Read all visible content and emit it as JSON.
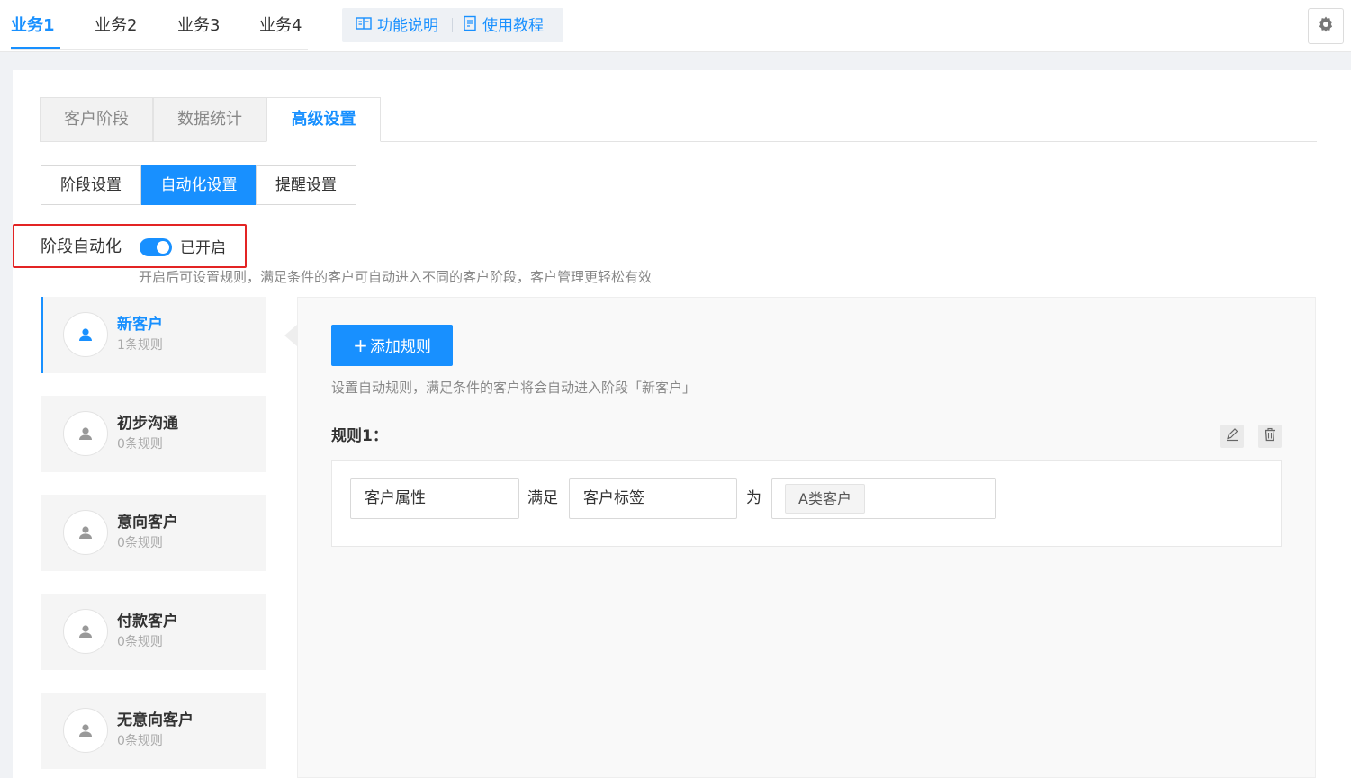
{
  "top_tabs": [
    "业务1",
    "业务2",
    "业务3",
    "业务4"
  ],
  "help_links": {
    "feature_label": "功能说明",
    "tutorial_label": "使用教程"
  },
  "main_tabs": [
    "客户阶段",
    "数据统计",
    "高级设置"
  ],
  "sub_tabs": [
    "阶段设置",
    "自动化设置",
    "提醒设置"
  ],
  "automation": {
    "label": "阶段自动化",
    "status": "已开启",
    "enabled": true,
    "hint": "开启后可设置规则，满足条件的客户可自动进入不同的客户阶段，客户管理更轻松有效"
  },
  "stages": [
    {
      "name": "新客户",
      "count": "1条规则"
    },
    {
      "name": "初步沟通",
      "count": "0条规则"
    },
    {
      "name": "意向客户",
      "count": "0条规则"
    },
    {
      "name": "付款客户",
      "count": "0条规则"
    },
    {
      "name": "无意向客户",
      "count": "0条规则"
    }
  ],
  "rules_panel": {
    "add_button": "添加规则",
    "hint": "设置自动规则，满足条件的客户将会自动进入阶段「新客户」",
    "rule_title": "规则1：",
    "rule": {
      "attribute": "客户属性",
      "op1": "满足",
      "field": "客户标签",
      "op2": "为",
      "value_chip": "A类客户"
    }
  },
  "colors": {
    "accent": "#1890ff",
    "highlight_border": "#e32424"
  },
  "icons": [
    "book-icon",
    "document-icon",
    "gear-icon",
    "user-icon",
    "edit-icon",
    "trash-icon"
  ]
}
